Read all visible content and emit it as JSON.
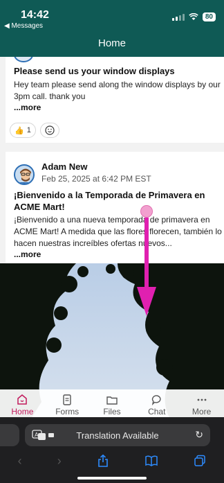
{
  "status": {
    "time": "14:42",
    "back": "◀ Messages",
    "battery": "80"
  },
  "header": {
    "title": "Home"
  },
  "post1": {
    "title": "Please send us your window displays",
    "body": "Hey team please send along the window displays by our 3pm call. thank you",
    "more": "...more",
    "reaction_count": "1"
  },
  "post2": {
    "author": "Adam New",
    "date": "Feb 25, 2025 at 6:42 PM EST",
    "title": "¡Bienvenido a la Temporada de Primavera en ACME Mart!",
    "body": "¡Bienvenido a una nueva temporada de primavera en ACME Mart! A medida que las flores florecen, también lo hacen nuestras increíbles ofertas nuevos...",
    "more": "...more"
  },
  "tabs": [
    {
      "label": "Home",
      "icon": "home-icon"
    },
    {
      "label": "Forms",
      "icon": "forms-icon"
    },
    {
      "label": "Files",
      "icon": "folder-icon"
    },
    {
      "label": "Chat",
      "icon": "chat-icon"
    },
    {
      "label": "More",
      "icon": "more-icon"
    }
  ],
  "browser": {
    "translation_label": "Translation Available"
  },
  "colors": {
    "header": "#0f5a55",
    "active_tab": "#c2185b",
    "gesture": "#e020b0",
    "safari_accent": "#2d8cff"
  }
}
